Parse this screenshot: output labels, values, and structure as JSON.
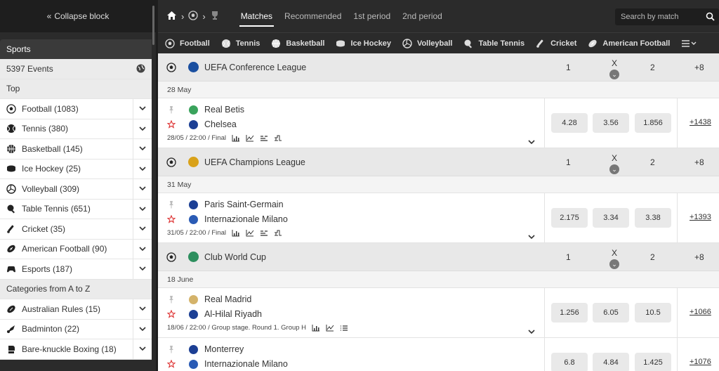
{
  "sidebar": {
    "collapse_label": "Collapse block",
    "header": "Sports",
    "events_count": "5397 Events",
    "top_label": "Top",
    "sports": [
      {
        "label": "Football (1083)",
        "icon": "football-icon"
      },
      {
        "label": "Tennis (380)",
        "icon": "tennis-icon"
      },
      {
        "label": "Basketball (145)",
        "icon": "basketball-icon"
      },
      {
        "label": "Ice Hockey (25)",
        "icon": "ice-hockey-icon"
      },
      {
        "label": "Volleyball (309)",
        "icon": "volleyball-icon"
      },
      {
        "label": "Table Tennis (651)",
        "icon": "table-tennis-icon"
      },
      {
        "label": "Cricket (35)",
        "icon": "cricket-icon"
      },
      {
        "label": "American Football (90)",
        "icon": "american-football-icon"
      },
      {
        "label": "Esports (187)",
        "icon": "esports-icon"
      }
    ],
    "categories_label": "Categories from A to Z",
    "categories": [
      {
        "label": "Australian Rules (15)",
        "icon": "australian-rules-icon"
      },
      {
        "label": "Badminton (22)",
        "icon": "badminton-icon"
      },
      {
        "label": "Bare-knuckle Boxing (18)",
        "icon": "boxing-icon"
      }
    ]
  },
  "topbar": {
    "tabs": [
      "Matches",
      "Recommended",
      "1st period",
      "2nd period"
    ],
    "active_tab": "Matches",
    "search_placeholder": "Search by match"
  },
  "sportsbar": [
    "Football",
    "Tennis",
    "Basketball",
    "Ice Hockey",
    "Volleyball",
    "Table Tennis",
    "Cricket",
    "American Football"
  ],
  "headers": {
    "one": "1",
    "x": "X",
    "two": "2"
  },
  "leagues": [
    {
      "name": "UEFA Conference League",
      "plus": "+8",
      "date": "28 May",
      "flag_color": "#1a4fa0",
      "matches": [
        {
          "team1": "Real Betis",
          "team2": "Chelsea",
          "meta": "28/05 / 22:00 / Final",
          "odds": [
            "4.28",
            "3.56",
            "1.856"
          ],
          "more": "+1438",
          "c1": "#3aa35c",
          "c2": "#1c3f94"
        }
      ]
    },
    {
      "name": "UEFA Champions League",
      "plus": "+8",
      "date": "31 May",
      "flag_color": "#d9a21a",
      "matches": [
        {
          "team1": "Paris Saint-Germain",
          "team2": "Internazionale Milano",
          "meta": "31/05 / 22:00 / Final",
          "odds": [
            "2.175",
            "3.34",
            "3.38"
          ],
          "more": "+1393",
          "c1": "#1c3f94",
          "c2": "#2a5bb5"
        }
      ]
    },
    {
      "name": "Club World Cup",
      "plus": "+8",
      "date": "18 June",
      "flag_color": "#2d8f5e",
      "matches": [
        {
          "team1": "Real Madrid",
          "team2": "Al-Hilal Riyadh",
          "meta": "18/06 / 22:00 / Group stage. Round 1. Group H",
          "odds": [
            "1.256",
            "6.05",
            "10.5"
          ],
          "more": "+1066",
          "c1": "#d4b36a",
          "c2": "#1c3f94"
        },
        {
          "team1": "Monterrey",
          "team2": "Internazionale Milano",
          "meta": "",
          "odds": [
            "6.8",
            "4.84",
            "1.425"
          ],
          "more": "+1076",
          "c1": "#1c3f94",
          "c2": "#2a5bb5"
        }
      ]
    }
  ]
}
